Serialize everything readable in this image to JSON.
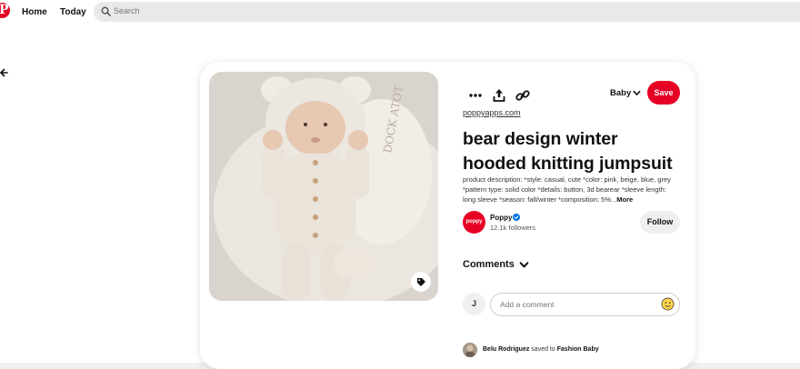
{
  "header": {
    "logo_letter": "P",
    "nav": [
      "Home",
      "Today"
    ],
    "search_placeholder": "Search"
  },
  "pin": {
    "board": "Baby",
    "save_label": "Save",
    "link": "poppyapps.com",
    "title": "bear design winter hooded knitting jumpsuit",
    "description": "product description: *style: casual, cute *color: pink, beige, blue, grey *pattern type: solid color *details: button, 3d bearear *sleeve length: long sleeve *season: fall/winter *composition: 5%...",
    "more_label": "More"
  },
  "creator": {
    "avatar_text": "poppy",
    "name": "Poppy",
    "followers": "12.1k followers",
    "follow_label": "Follow"
  },
  "comments": {
    "heading": "Comments",
    "user_initial": "J",
    "placeholder": "Add a comment"
  },
  "saved_by": {
    "user": "Belu Rodriguez",
    "verb": "saved to",
    "board": "Fashion Baby"
  },
  "colors": {
    "brand": "#e60023",
    "verified": "#0074e8"
  },
  "icons": [
    "back-arrow-icon",
    "search-icon",
    "more-icon",
    "share-icon",
    "link-icon",
    "chevron-down-icon",
    "verified-icon",
    "tag-icon",
    "emoji-icon"
  ]
}
